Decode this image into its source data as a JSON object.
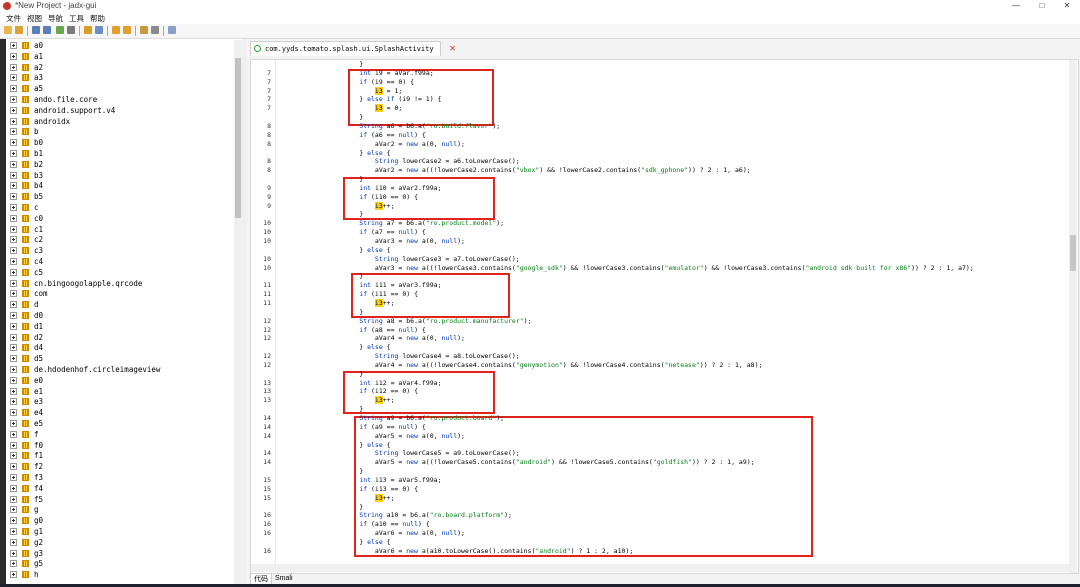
{
  "window": {
    "title": "*New Project - jadx-gui",
    "controls": [
      "—",
      "□",
      "✕"
    ]
  },
  "menu": [
    "文件",
    "视图",
    "导航",
    "工具",
    "帮助"
  ],
  "toolbar": {
    "icons": [
      "open-file-icon",
      "add-file-icon",
      "save-icon",
      "save-all-icon",
      "sync-icon",
      "export-icon",
      "wand-icon",
      "search-icon",
      "back-icon",
      "forward-icon",
      "decompile-icon",
      "log-icon",
      "settings-icon"
    ]
  },
  "tree": {
    "items": [
      "a0",
      "a1",
      "a2",
      "a3",
      "a5",
      "ando.file.core",
      "android.support.v4",
      "androidx",
      "b",
      "b0",
      "b1",
      "b2",
      "b3",
      "b4",
      "b5",
      "c",
      "c0",
      "c1",
      "c2",
      "c3",
      "c4",
      "c5",
      "cn.bingoogolapple.qrcode",
      "com",
      "d",
      "d0",
      "d1",
      "d2",
      "d4",
      "d5",
      "de.hdodenhof.circleimageview",
      "e0",
      "e1",
      "e3",
      "e4",
      "e5",
      "f",
      "f0",
      "f1",
      "f2",
      "f3",
      "f4",
      "f5",
      "g",
      "g0",
      "g1",
      "g2",
      "g3",
      "g5",
      "h"
    ]
  },
  "editor": {
    "tab_label": "com.yyds.tomato.splash.ui.SplashActivity",
    "close_glyph": "✕",
    "bottom_tabs": [
      "代码",
      "Smali"
    ]
  },
  "code": {
    "lines": [
      {
        "n": "",
        "t": "                    }"
      },
      {
        "n": "7",
        "t": "                    int i9 = aVar.f99a;"
      },
      {
        "n": "7",
        "t": "                    if (i9 == 0) {"
      },
      {
        "n": "7",
        "t": "                        i3 = 1;"
      },
      {
        "n": "7",
        "t": "                    } else if (i9 != 1) {"
      },
      {
        "n": "7",
        "t": "                        i3 = 0;"
      },
      {
        "n": "",
        "t": "                    }"
      },
      {
        "n": "8",
        "t": "                    String a6 = b6.a(\"ro.build.flavor\");"
      },
      {
        "n": "8",
        "t": "                    if (a6 == null) {"
      },
      {
        "n": "8",
        "t": "                        aVar2 = new a(0, null);"
      },
      {
        "n": "",
        "t": "                    } else {"
      },
      {
        "n": "8",
        "t": "                        String lowerCase2 = a6.toLowerCase();"
      },
      {
        "n": "8",
        "t": "                        aVar2 = new a((!lowerCase2.contains(\"vbox\") && !lowerCase2.contains(\"sdk_gphone\")) ? 2 : 1, a6);"
      },
      {
        "n": "",
        "t": "                    }"
      },
      {
        "n": "9",
        "t": "                    int i10 = aVar2.f99a;"
      },
      {
        "n": "9",
        "t": "                    if (i10 == 0) {"
      },
      {
        "n": "9",
        "t": "                        i3++;"
      },
      {
        "n": "",
        "t": "                    }"
      },
      {
        "n": "10",
        "t": "                    String a7 = b6.a(\"ro.product.model\");"
      },
      {
        "n": "10",
        "t": "                    if (a7 == null) {"
      },
      {
        "n": "10",
        "t": "                        aVar3 = new a(0, null);"
      },
      {
        "n": "",
        "t": "                    } else {"
      },
      {
        "n": "10",
        "t": "                        String lowerCase3 = a7.toLowerCase();"
      },
      {
        "n": "10",
        "t": "                        aVar3 = new a((!lowerCase3.contains(\"google_sdk\") && !lowerCase3.contains(\"emulator\") && !lowerCase3.contains(\"android sdk built for x86\")) ? 2 : 1, a7);"
      },
      {
        "n": "",
        "t": "                    }"
      },
      {
        "n": "11",
        "t": "                    int i11 = aVar3.f99a;"
      },
      {
        "n": "11",
        "t": "                    if (i11 == 0) {"
      },
      {
        "n": "11",
        "t": "                        i3++;"
      },
      {
        "n": "",
        "t": "                    }"
      },
      {
        "n": "12",
        "t": "                    String a8 = b6.a(\"ro.product.manufacturer\");"
      },
      {
        "n": "12",
        "t": "                    if (a8 == null) {"
      },
      {
        "n": "12",
        "t": "                        aVar4 = new a(0, null);"
      },
      {
        "n": "",
        "t": "                    } else {"
      },
      {
        "n": "12",
        "t": "                        String lowerCase4 = a8.toLowerCase();"
      },
      {
        "n": "12",
        "t": "                        aVar4 = new a((!lowerCase4.contains(\"genymotion\") && !lowerCase4.contains(\"netease\")) ? 2 : 1, a8);"
      },
      {
        "n": "",
        "t": "                    }"
      },
      {
        "n": "13",
        "t": "                    int i12 = aVar4.f99a;"
      },
      {
        "n": "13",
        "t": "                    if (i12 == 0) {"
      },
      {
        "n": "13",
        "t": "                        i3++;"
      },
      {
        "n": "",
        "t": "                    }"
      },
      {
        "n": "14",
        "t": "                    String a9 = b6.a(\"ro.product.board\");"
      },
      {
        "n": "14",
        "t": "                    if (a9 == null) {"
      },
      {
        "n": "14",
        "t": "                        aVar5 = new a(0, null);"
      },
      {
        "n": "",
        "t": "                    } else {"
      },
      {
        "n": "14",
        "t": "                        String lowerCase5 = a9.toLowerCase();"
      },
      {
        "n": "14",
        "t": "                        aVar5 = new a((!lowerCase5.contains(\"android\") && !lowerCase5.contains(\"goldfish\")) ? 2 : 1, a9);"
      },
      {
        "n": "",
        "t": "                    }"
      },
      {
        "n": "15",
        "t": "                    int i13 = aVar5.f99a;"
      },
      {
        "n": "15",
        "t": "                    if (i13 == 0) {"
      },
      {
        "n": "15",
        "t": "                        i3++;"
      },
      {
        "n": "",
        "t": "                    }"
      },
      {
        "n": "16",
        "t": "                    String a10 = b6.a(\"ro.board.platform\");"
      },
      {
        "n": "16",
        "t": "                    if (a10 == null) {"
      },
      {
        "n": "16",
        "t": "                        aVar6 = new a(0, null);"
      },
      {
        "n": "",
        "t": "                    } else {"
      },
      {
        "n": "16",
        "t": "                        aVar6 = new a(a10.toLowerCase().contains(\"android\") ? 1 : 2, a10);"
      }
    ]
  },
  "colors": {
    "highlight_box": "#e0241b",
    "keyword": "#0033b3",
    "string": "#067d17",
    "search_highlight": "#ffd21a"
  }
}
